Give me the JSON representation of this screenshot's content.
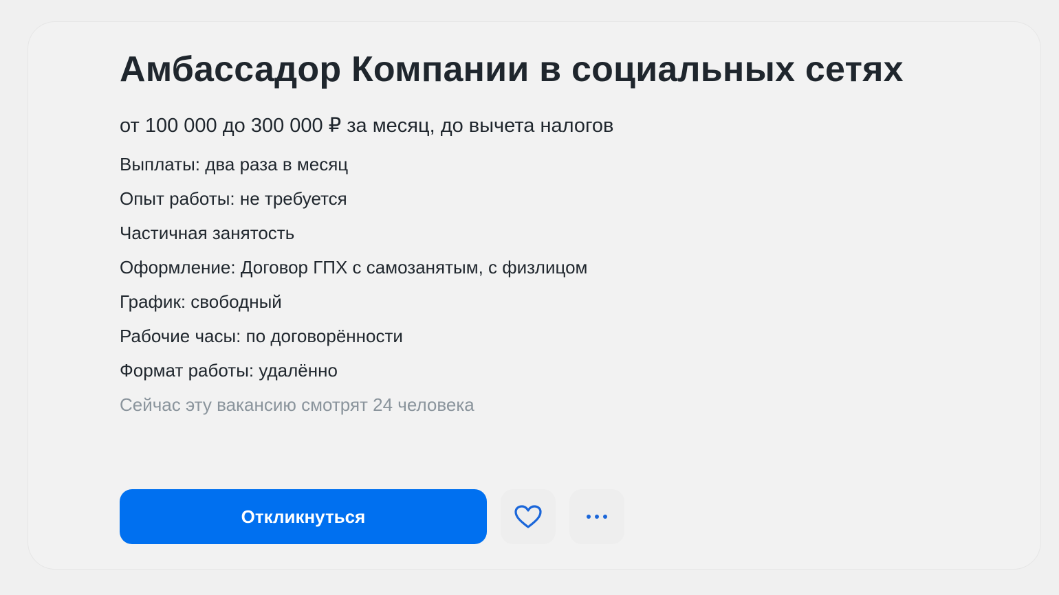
{
  "vacancy": {
    "title": "Амбассадор Компании в социальных сетях",
    "salary": "от 100 000 до 300 000 ₽ за месяц, до вычета налогов",
    "details": [
      "Выплаты: два раза в месяц",
      "Опыт работы: не требуется",
      "Частичная занятость",
      "Оформление: Договор ГПХ с самозанятым, с физлицом",
      "График: свободный",
      "Рабочие часы: по договорённости",
      "Формат работы: удалённо"
    ],
    "viewers": "Сейчас эту вакансию смотрят 24 человека"
  },
  "actions": {
    "apply_label": "Откликнуться",
    "favorite_icon": "heart-icon",
    "more_icon": "more-dots-icon"
  },
  "colors": {
    "accent": "#0070f0",
    "icon": "#1a66d9",
    "text": "#1f262d",
    "muted": "#8a949c",
    "card_bg": "#f2f2f2"
  }
}
